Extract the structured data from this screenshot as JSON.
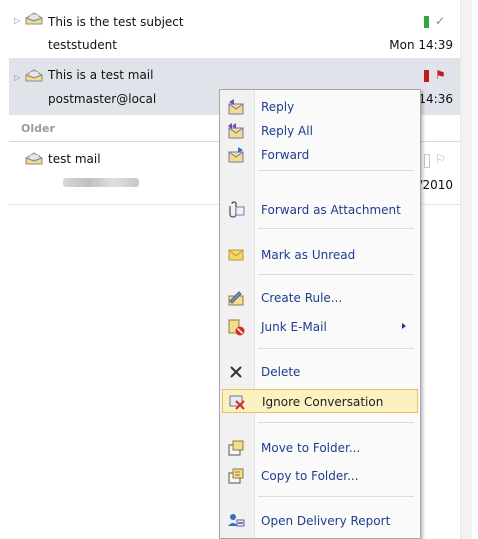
{
  "messages": [
    {
      "subject": "This is the test subject",
      "from": "teststudent",
      "date": "Mon 14:39",
      "category_color": "#35a63a",
      "flag": "✓",
      "flag_color": "#8a8a8a"
    },
    {
      "subject": "This is a test mail",
      "from": "postmaster@local",
      "date": "14:36",
      "category_color": "#c21a1a",
      "flag": "⚑",
      "flag_color": "#c21a1a",
      "selected": true
    },
    {
      "subject": "test mail",
      "from": "",
      "date": "/2010",
      "category_color": "#d9d9d9",
      "flag": "⚐",
      "flag_color": "#b5b5b5"
    }
  ],
  "group_header": "Older",
  "context_menu": {
    "items": [
      {
        "label": "Reply",
        "icon": "reply-icon"
      },
      {
        "label": "Reply All",
        "icon": "reply-all-icon"
      },
      {
        "label": "Forward",
        "icon": "forward-icon"
      },
      {
        "label": "Forward as Attachment",
        "icon": "forward-attachment-icon"
      },
      {
        "label": "Mark as Unread",
        "icon": "mark-unread-icon"
      },
      {
        "label": "Create Rule...",
        "icon": "create-rule-icon"
      },
      {
        "label": "Junk E-Mail",
        "icon": "junk-email-icon",
        "submenu": true
      },
      {
        "label": "Delete",
        "icon": "delete-icon"
      },
      {
        "label": "Ignore Conversation",
        "icon": "ignore-conversation-icon",
        "highlighted": true
      },
      {
        "label": "Move to Folder...",
        "icon": "move-to-folder-icon"
      },
      {
        "label": "Copy to Folder...",
        "icon": "copy-to-folder-icon"
      },
      {
        "label": "Open Delivery Report",
        "icon": "delivery-report-icon"
      }
    ]
  }
}
